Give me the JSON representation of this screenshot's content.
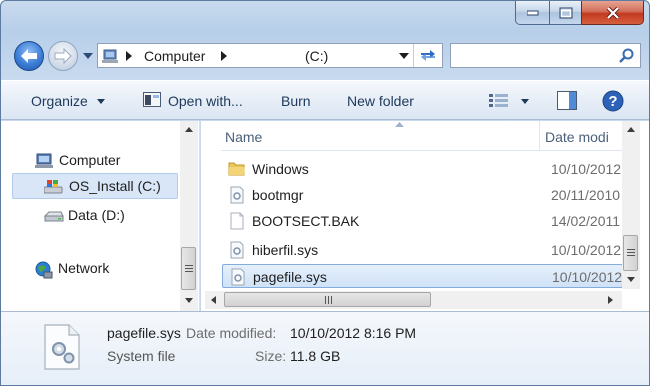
{
  "window": {
    "caption_buttons": [
      "minimize",
      "maximize",
      "close"
    ]
  },
  "address_bar": {
    "path": [
      "Computer",
      "(C:)"
    ],
    "icon": "computer-icon"
  },
  "search": {
    "placeholder": "",
    "value": ""
  },
  "toolbar": {
    "organize": "Organize",
    "open_with": "Open with...",
    "burn": "Burn",
    "new_folder": "New folder"
  },
  "nav_pane": {
    "items": [
      {
        "label": "Computer",
        "icon": "computer-icon"
      },
      {
        "label": "OS_Install (C:)",
        "icon": "drive-windows-icon",
        "selected": true
      },
      {
        "label": "Data (D:)",
        "icon": "drive-icon"
      },
      {
        "label": "Network",
        "icon": "network-icon"
      }
    ]
  },
  "file_list": {
    "columns": {
      "name": "Name",
      "date": "Date modi"
    },
    "files": [
      {
        "name": "Windows",
        "date": "10/10/2012",
        "icon": "folder-icon"
      },
      {
        "name": "bootmgr",
        "date": "20/11/2010",
        "icon": "system-file-icon"
      },
      {
        "name": "BOOTSECT.BAK",
        "date": "14/02/2011",
        "icon": "blank-file-icon"
      },
      {
        "name": "hiberfil.sys",
        "date": "10/10/2012",
        "icon": "system-file-icon"
      },
      {
        "name": "pagefile.sys",
        "date": "10/10/2012",
        "icon": "system-file-icon",
        "selected": true
      }
    ]
  },
  "details": {
    "name": "pagefile.sys",
    "type": "System file",
    "modified_label": "Date modified:",
    "modified_value": "10/10/2012 8:16 PM",
    "size_label": "Size:",
    "size_value": "11.8 GB"
  }
}
